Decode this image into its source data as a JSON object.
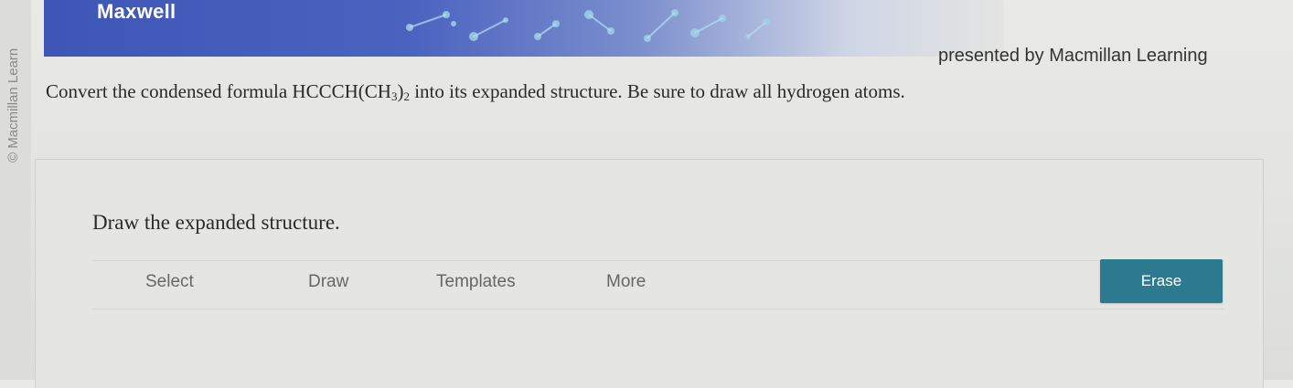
{
  "sidebar": {
    "copyright_text": "© Macmillan Learn"
  },
  "header": {
    "brand": "Maxwell",
    "presented_by": "presented by Macmillan Learning"
  },
  "question": {
    "prefix": "Convert the condensed formula HCCCH(CH",
    "sub1": "3",
    "mid": ")",
    "sub2": "2",
    "suffix": " into its expanded structure. Be sure to draw all hydrogen atoms."
  },
  "panel": {
    "title": "Draw the expanded structure.",
    "toolbar": {
      "select_label": "Select",
      "draw_label": "Draw",
      "templates_label": "Templates",
      "more_label": "More",
      "erase_label": "Erase"
    }
  },
  "colors": {
    "banner_blue": "#4a63bf",
    "erase_button": "#2b7a8f"
  }
}
